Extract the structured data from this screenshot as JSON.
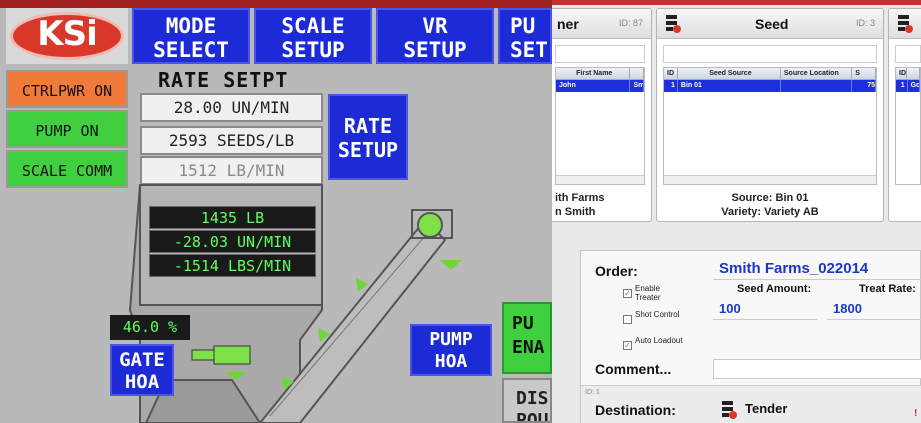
{
  "hmi": {
    "logo_text": "KSi",
    "nav": [
      {
        "line1": "MODE",
        "line2": "SELECT"
      },
      {
        "line1": "SCALE",
        "line2": "SETUP"
      },
      {
        "line1": "VR",
        "line2": "SETUP"
      },
      {
        "line1": "PU",
        "line2": "SET"
      }
    ],
    "status": [
      {
        "label": "CTRLPWR ON",
        "color": "#f07a3a"
      },
      {
        "label": "PUMP ON",
        "color": "#3fcf3f"
      },
      {
        "label": "SCALE COMM",
        "color": "#3fcf3f"
      }
    ],
    "rate_setpt_title": "RATE SETPT",
    "rate_values": [
      "28.00 UN/MIN",
      "2593 SEEDS/LB",
      "1512 LB/MIN"
    ],
    "rate_setup_line1": "RATE",
    "rate_setup_line2": "SETUP",
    "readouts": [
      "1435 LB",
      "-28.03 UN/MIN",
      "-1514 LBS/MIN"
    ],
    "gate_percent": "46.0 %",
    "gate_hoa_line1": "GATE",
    "gate_hoa_line2": "HOA",
    "pump_hoa_line1": "PUMP",
    "pump_hoa_line2": "HOA",
    "pump_enable_line1": "PU",
    "pump_enable_line2": "ENA",
    "dis_line1": "DIS",
    "dis_line2": "POU",
    "accent_blue": "#1c2bd6",
    "readout_green": "#5eff5e"
  },
  "software": {
    "customer_card": {
      "title": "ner",
      "id": "ID: 87",
      "columns": [
        "First Name",
        ""
      ],
      "row": [
        "John",
        "Sm"
      ],
      "footer1": "ith Farms",
      "footer2": "n Smith"
    },
    "seed_card": {
      "title": "Seed",
      "id": "ID: 3",
      "columns": [
        "ID",
        "Seed Source",
        "Source Location",
        "S"
      ],
      "row": [
        "1",
        "Bin 01",
        "",
        "75"
      ],
      "footer1": "Source: Bin 01",
      "footer2": "Variety: Variety AB"
    },
    "third_card": {
      "columns": [
        "ID",
        ""
      ],
      "row": [
        "1",
        "Go"
      ]
    },
    "order": {
      "label": "Order:",
      "name": "Smith Farms_022014",
      "options": [
        {
          "label": "Enable Treater",
          "checked": true
        },
        {
          "label": "Shot Control",
          "checked": false
        },
        {
          "label": "Auto Loadout",
          "checked": true
        }
      ],
      "seed_amount_label": "Seed Amount:",
      "seed_amount_value": "100",
      "treat_rate_label": "Treat Rate:",
      "treat_rate_value": "1800",
      "comment_label": "Comment...",
      "destination_id": "ID: 1",
      "destination_label": "Destination:",
      "destination_value": "Tender"
    },
    "accent_blue": "#1a37c8",
    "selection_blue": "#1f2fe0"
  }
}
